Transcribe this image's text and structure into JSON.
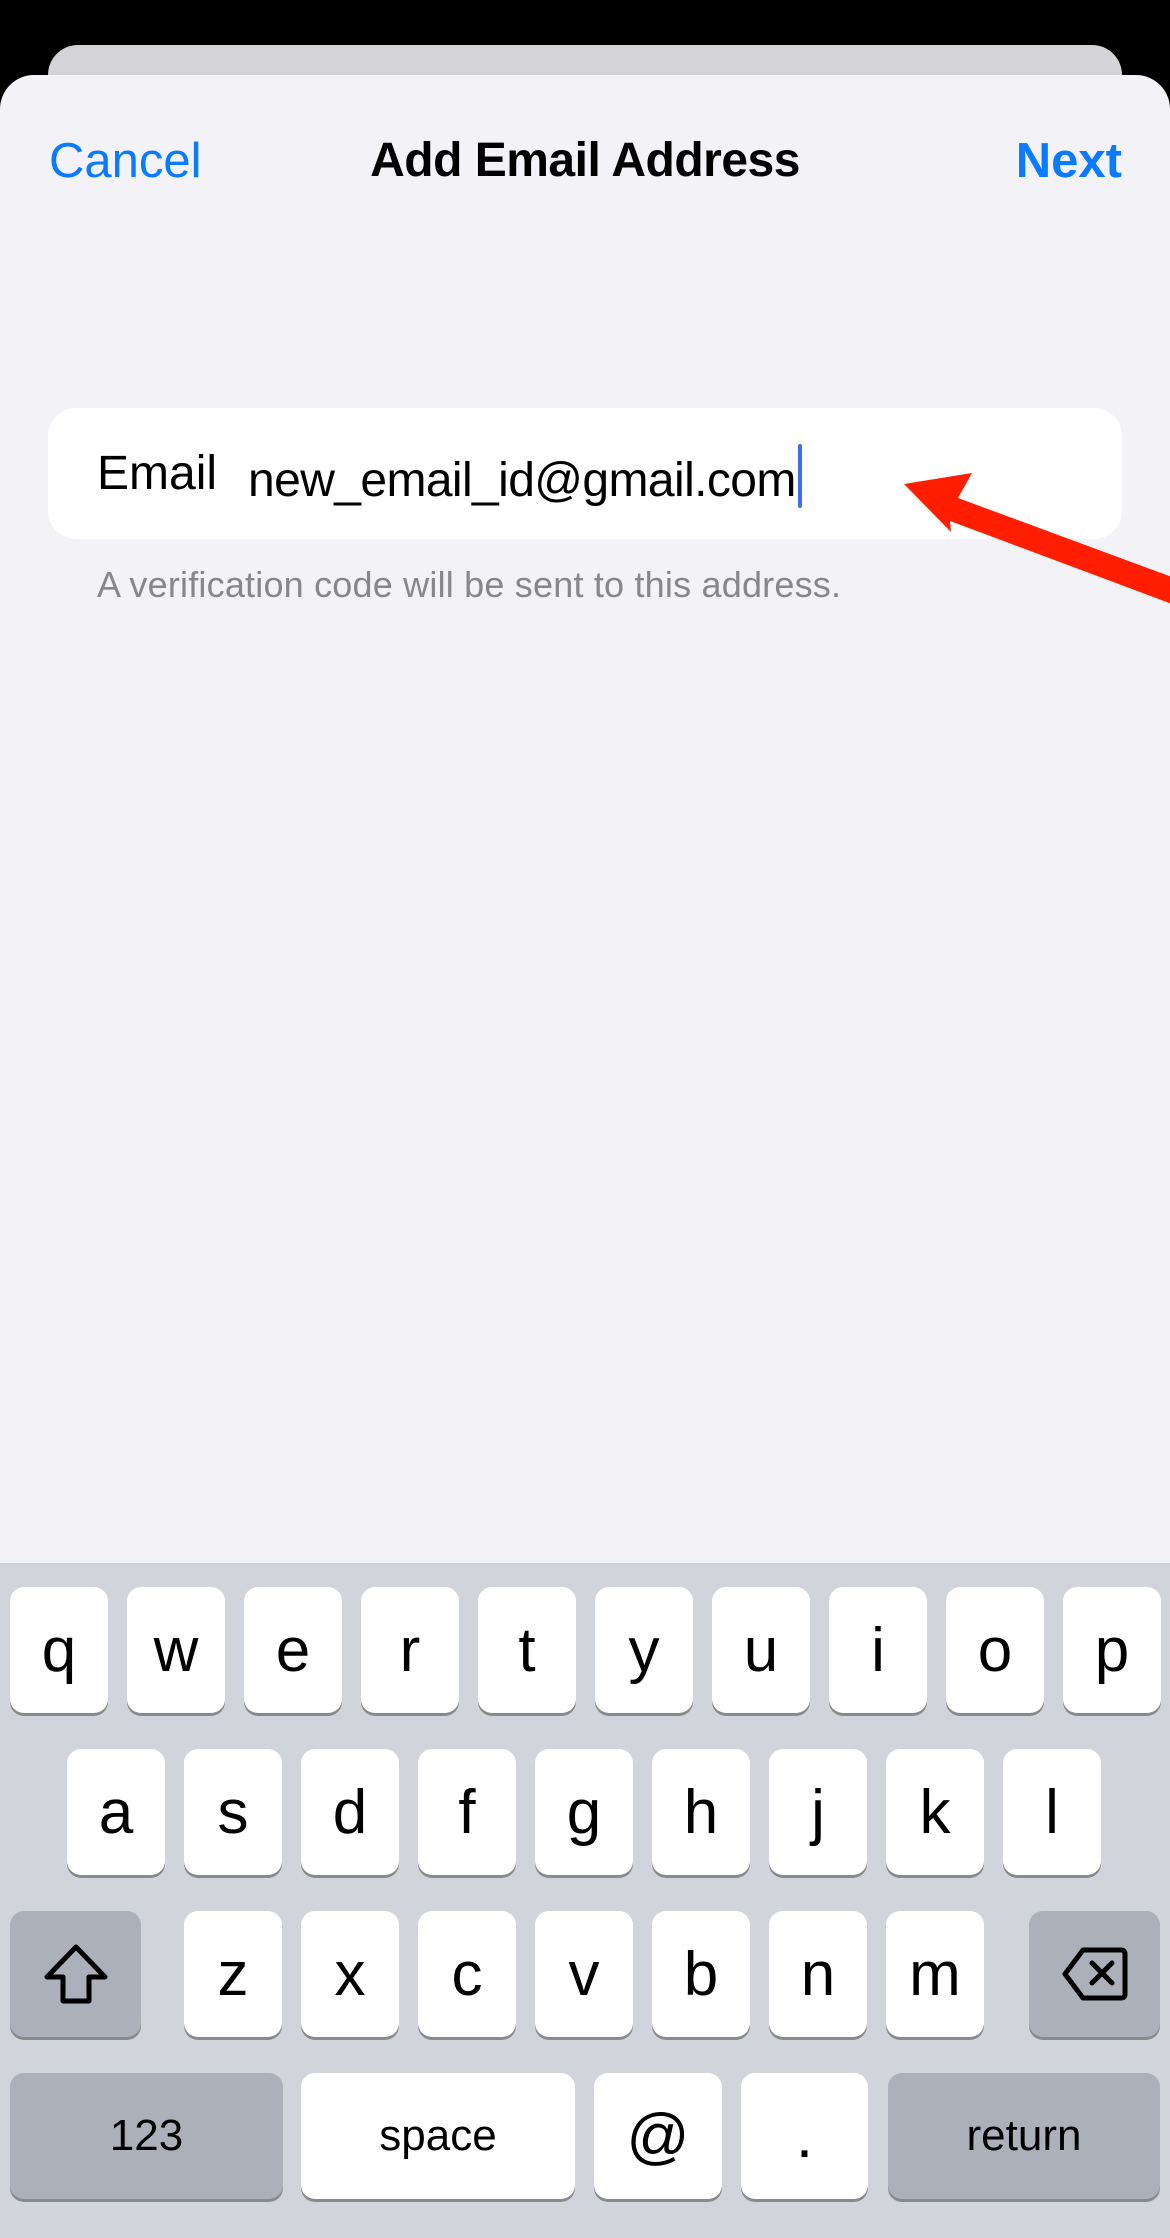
{
  "header": {
    "cancel_label": "Cancel",
    "title": "Add Email Address",
    "next_label": "Next"
  },
  "form": {
    "email_label": "Email",
    "email_value": "new_email_id@gmail.com",
    "caption": "A verification code will be sent to this address."
  },
  "annotation": {
    "type": "red-arrow",
    "points_to": "email-input",
    "color": "#ff1f00"
  },
  "keyboard": {
    "row1": [
      "q",
      "w",
      "e",
      "r",
      "t",
      "y",
      "u",
      "i",
      "o",
      "p"
    ],
    "row2": [
      "a",
      "s",
      "d",
      "f",
      "g",
      "h",
      "j",
      "k",
      "l"
    ],
    "row3": [
      "z",
      "x",
      "c",
      "v",
      "b",
      "n",
      "m"
    ],
    "shift_icon": "shift-icon",
    "delete_icon": "delete-backward-icon",
    "numbers_label": "123",
    "space_label": "space",
    "at_label": "@",
    "period_label": ".",
    "return_label": "return"
  },
  "colors": {
    "accent": "#0a7aff",
    "caret": "#3d6ef5",
    "sheet_background": "#f2f2f7",
    "keyboard_background": "#d1d4da",
    "special_key": "#abb0ba"
  }
}
